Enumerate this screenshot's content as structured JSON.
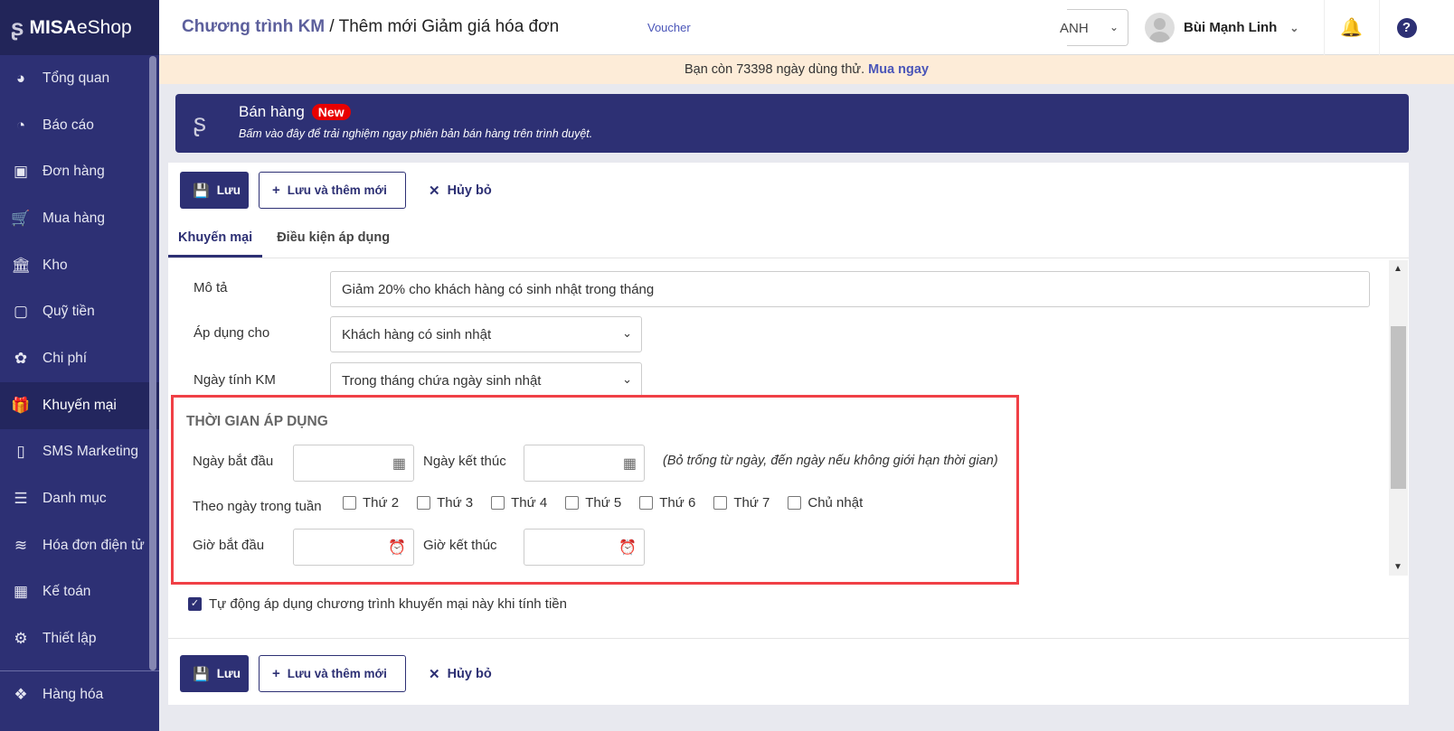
{
  "brand": {
    "name_bold": "MISA",
    "name_rest": "eShop"
  },
  "sidebar": {
    "items": [
      {
        "label": "Tổng quan",
        "icon": "dashboard-icon",
        "glyph": "◕"
      },
      {
        "label": "Báo cáo",
        "icon": "pie-chart-icon",
        "glyph": "◔"
      },
      {
        "label": "Đơn hàng",
        "icon": "order-icon",
        "glyph": "▣"
      },
      {
        "label": "Mua hàng",
        "icon": "cart-icon",
        "glyph": "🛒"
      },
      {
        "label": "Kho",
        "icon": "warehouse-icon",
        "glyph": "🏛"
      },
      {
        "label": "Quỹ tiền",
        "icon": "safe-icon",
        "glyph": "▢"
      },
      {
        "label": "Chi phí",
        "icon": "expense-icon",
        "glyph": "✿"
      },
      {
        "label": "Khuyến mại",
        "icon": "gift-icon",
        "glyph": "🎁"
      },
      {
        "label": "SMS Marketing",
        "icon": "phone-icon",
        "glyph": "▯"
      },
      {
        "label": "Danh mục",
        "icon": "list-icon",
        "glyph": "☰"
      },
      {
        "label": "Hóa đơn điện tử",
        "icon": "invoice-icon",
        "glyph": "≋"
      },
      {
        "label": "Kế toán",
        "icon": "calculator-icon",
        "glyph": "▦"
      },
      {
        "label": "Thiết lập",
        "icon": "gear-icon",
        "glyph": "⚙"
      }
    ],
    "last": {
      "label": "Hàng hóa",
      "icon": "boxes-icon",
      "glyph": "❖"
    }
  },
  "header": {
    "crumb_parent": "Chương trình KM",
    "crumb_sep": "/",
    "crumb_current": "Thêm mới Giảm giá hóa đơn",
    "voucher": "Voucher",
    "shop": "ANH",
    "user": "Bùi Mạnh Linh"
  },
  "trial": {
    "text": "Bạn còn 73398 ngày dùng thử.",
    "link": "Mua ngay"
  },
  "promo": {
    "title": "Bán hàng",
    "badge": "New",
    "subtitle": "Bấm vào đây để trải nghiệm ngay phiên bản bán hàng trên trình duyệt."
  },
  "toolbar": {
    "save": "Lưu",
    "save_new": "Lưu và thêm mới",
    "cancel": "Hủy bỏ"
  },
  "tabs": [
    "Khuyến mại",
    "Điều kiện áp dụng"
  ],
  "form": {
    "desc_label": "Mô tả",
    "desc_value": "Giảm 20% cho khách hàng có sinh nhật trong tháng",
    "apply_label": "Áp dụng cho",
    "apply_value": "Khách hàng có sinh nhật",
    "date_label": "Ngày tính KM",
    "date_value": "Trong tháng chứa ngày sinh nhật",
    "section_title": "THỜI GIAN ÁP DỤNG",
    "start_date": "Ngày bắt đầu",
    "end_date": "Ngày kết thúc",
    "date_hint": "(Bỏ trống từ ngày, đến ngày nếu không giới hạn thời gian)",
    "weekday_label": "Theo ngày trong tuần",
    "weekdays": [
      "Thứ 2",
      "Thứ 3",
      "Thứ 4",
      "Thứ 5",
      "Thứ 6",
      "Thứ 7",
      "Chủ nhật"
    ],
    "start_time": "Giờ bắt đầu",
    "end_time": "Giờ kết thúc",
    "auto_apply": "Tự động áp dụng chương trình khuyến mại này khi tính tiền",
    "auto_apply_checked": true
  }
}
